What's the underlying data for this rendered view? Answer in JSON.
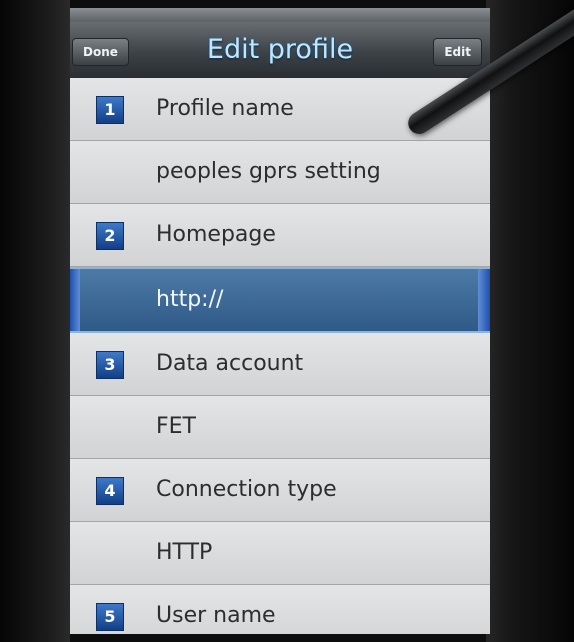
{
  "header": {
    "title": "Edit profile",
    "left_button": "Done",
    "right_button": "Edit"
  },
  "rows": [
    {
      "kind": "header",
      "index": "1",
      "label": "Profile name"
    },
    {
      "kind": "value",
      "label": "peoples gprs setting"
    },
    {
      "kind": "header",
      "index": "2",
      "label": "Homepage"
    },
    {
      "kind": "value",
      "label": "http://",
      "selected": true
    },
    {
      "kind": "header",
      "index": "3",
      "label": "Data account"
    },
    {
      "kind": "value",
      "label": "FET"
    },
    {
      "kind": "header",
      "index": "4",
      "label": "Connection type"
    },
    {
      "kind": "value",
      "label": "HTTP"
    },
    {
      "kind": "header",
      "index": "5",
      "label": "User name"
    }
  ],
  "colors": {
    "selection": "#3f6a97",
    "title_text": "#bfe6ff",
    "list_bg": "#d9dadb"
  }
}
